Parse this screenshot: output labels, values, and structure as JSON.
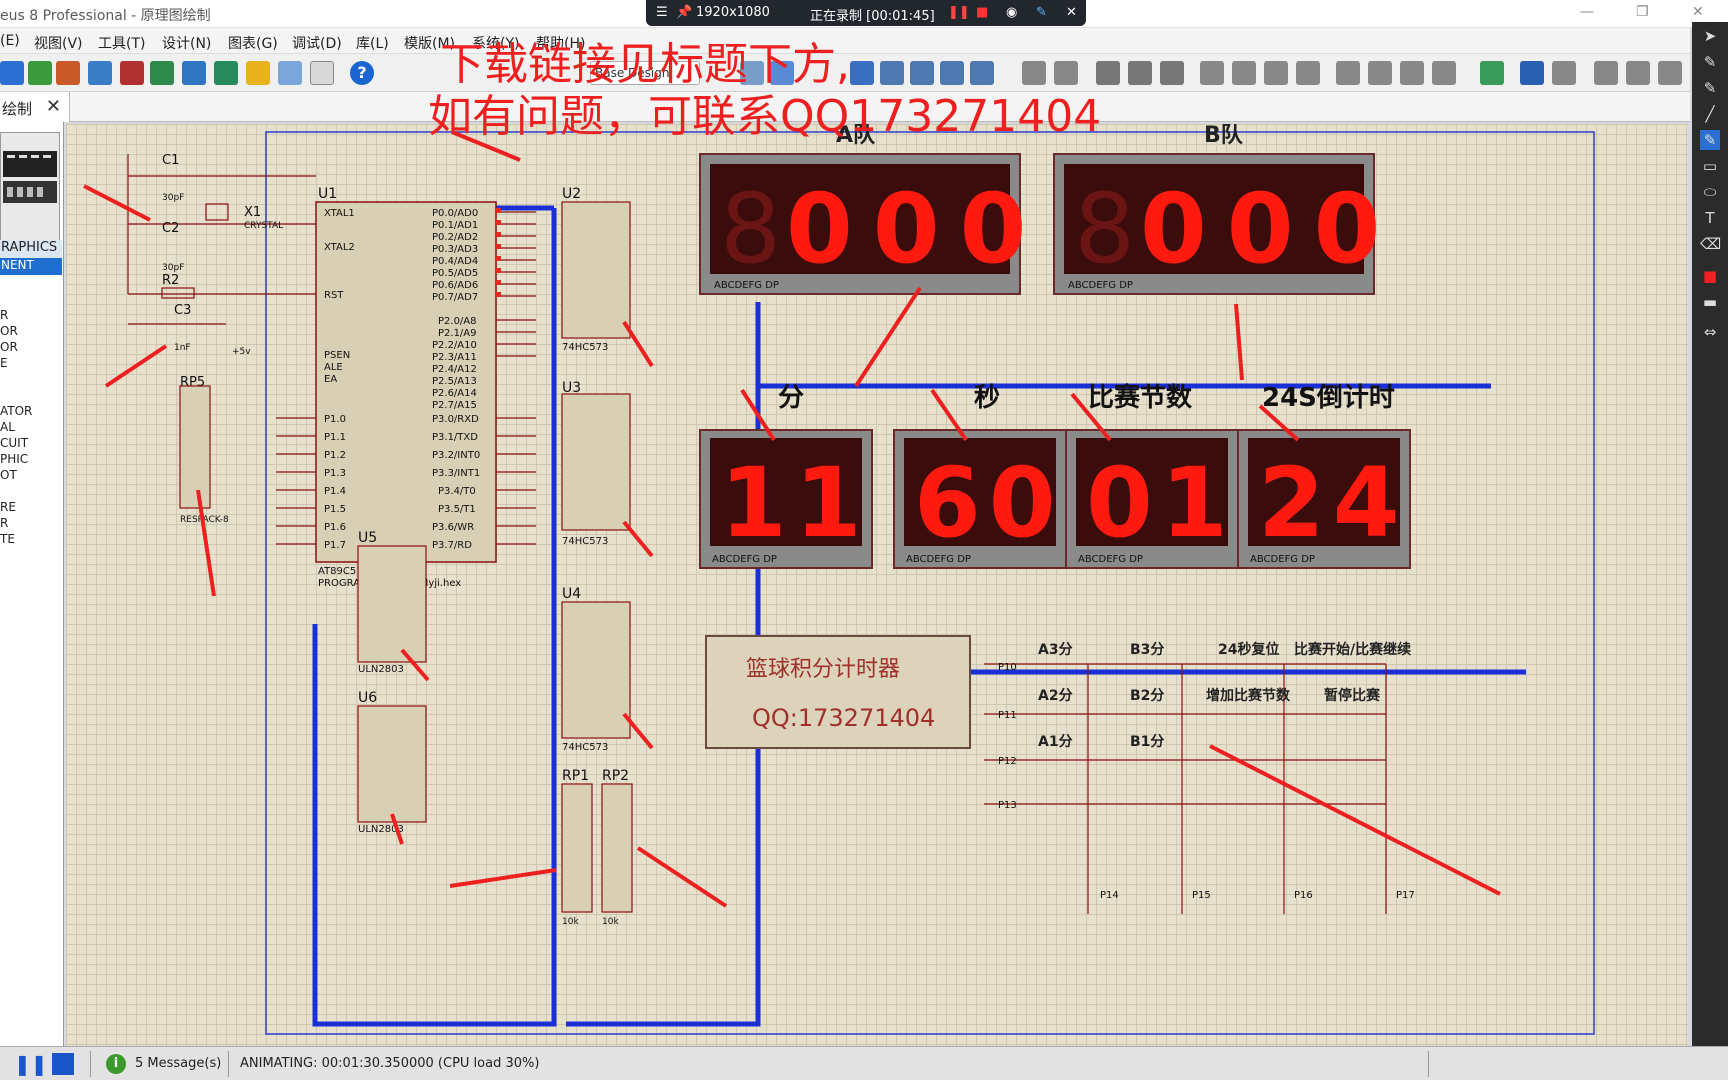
{
  "window": {
    "title": "eus 8 Professional - 原理图绘制"
  },
  "recorder": {
    "resolution": "1920x1080",
    "status": "正在录制 [00:01:45]"
  },
  "menu": {
    "items": [
      "(E)",
      "视图(V)",
      "工具(T)",
      "设计(N)",
      "图表(G)",
      "调试(D)",
      "库(L)",
      "模版(M)",
      "系统(Y)",
      "帮助(H)"
    ]
  },
  "tab": {
    "label": "绘制"
  },
  "toolbar": {
    "base_design_label": "Base Design"
  },
  "sidebar": {
    "header": "RAPHICS",
    "selected": "NENT",
    "items": [
      "R",
      "OR",
      "OR",
      "E",
      "ATOR",
      "AL",
      "CUIT",
      "PHIC",
      "OT",
      "RE",
      "R",
      "TE"
    ]
  },
  "overlay": {
    "line1": "下载链接见标题下方,",
    "line2": "如有问题，可联系QQ173271404"
  },
  "schematic": {
    "team_a_label": "A队",
    "team_b_label": "B队",
    "team_a_digits": "000",
    "team_b_digits": "000",
    "labels": {
      "minutes": "分",
      "seconds": "秒",
      "round": "比赛节数",
      "shot_clock": "24S倒计时"
    },
    "minutes": "11",
    "seconds": "60",
    "round": "01",
    "shot_clock": "24",
    "seg_pins": "ABCDEFG  DP",
    "title_box": {
      "line1": "篮球积分计时器",
      "line2": "QQ:173271404"
    },
    "buttons": [
      "A3分",
      "B3分",
      "24秒复位",
      "比赛开始/比赛继续",
      "A2分",
      "B2分",
      "增加比赛节数",
      "暂停比赛",
      "A1分",
      "B1分"
    ],
    "key_rows": [
      "P10",
      "P11",
      "P12",
      "P13"
    ],
    "key_cols": [
      "P14",
      "P15",
      "P16",
      "P17"
    ],
    "chips": {
      "u1": "U1",
      "u1_model": "AT89C51",
      "u1_program": "PROGRAM=..\\程序\\pinlyji.hex",
      "u2": "U2",
      "u3": "U3",
      "u4": "U4",
      "latch_model": "74HC573",
      "u5": "U5",
      "u6": "U6",
      "uln": "ULN2803",
      "rp1": "RP1",
      "rp2": "RP2",
      "rp5": "RP5",
      "rp5_model": "RESPACK-8",
      "rp_value": "10k",
      "x1": "X1",
      "crystal": "CRYSTAL",
      "c1": "C1",
      "c2": "C2",
      "c3": "C3",
      "r2": "R2",
      "c_value": "30pF",
      "c3_value": "1nF",
      "vcc": "+5v"
    }
  },
  "status": {
    "messages": "5 Message(s)",
    "animating": "ANIMATING: 00:01:30.350000 (CPU load 30%)"
  },
  "colors": {
    "segment_on": "#ff1a10",
    "segment_off": "#6a1414",
    "display_bg": "#3a0c0c",
    "bus": "#1b2fd6",
    "annotation": "#ee1f1f"
  }
}
